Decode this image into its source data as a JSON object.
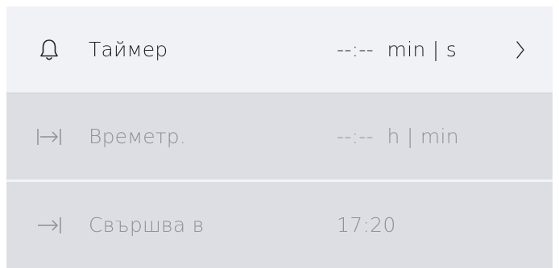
{
  "rows": [
    {
      "icon": "bell-icon",
      "label": "Таймер",
      "value": "--:--  min | s",
      "has_chevron": true,
      "state": "active"
    },
    {
      "icon": "duration-icon",
      "label": "Времетр.",
      "value": "--:--  h | min",
      "has_chevron": false,
      "state": "disabled"
    },
    {
      "icon": "end-time-icon",
      "label": "Свършва в",
      "value": "17:20",
      "has_chevron": false,
      "state": "disabled"
    }
  ],
  "colors": {
    "active_row_bg": "#f1f2f5",
    "disabled_row_bg": "#dcdee3",
    "active_text": "#1f2126",
    "muted_text": "#8c9098"
  }
}
